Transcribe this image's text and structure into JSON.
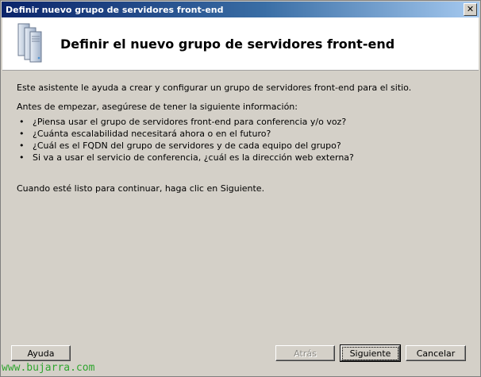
{
  "window": {
    "title": "Definir nuevo grupo de servidores front-end",
    "close_glyph": "✕"
  },
  "header": {
    "icon": "server-stack-icon",
    "title": "Definir el nuevo grupo de servidores front-end"
  },
  "content": {
    "intro": "Este asistente le ayuda a crear y configurar un grupo de servidores front-end para el sitio.",
    "before": "Antes de empezar, asegúrese de tener la siguiente información:",
    "bullets": [
      "¿Piensa usar el grupo de servidores front-end para conferencia y/o voz?",
      "¿Cuánta escalabilidad necesitará ahora o en el futuro?",
      "¿Cuál es el FQDN del grupo de servidores y de cada equipo del grupo?",
      "Si va a usar el servicio de conferencia, ¿cuál es la dirección web externa?"
    ],
    "ready": "Cuando esté listo para continuar, haga clic en Siguiente."
  },
  "buttons": {
    "help": "Ayuda",
    "back": "Atrás",
    "next": "Siguiente",
    "cancel": "Cancelar"
  },
  "watermark": "www.bujarra.com"
}
